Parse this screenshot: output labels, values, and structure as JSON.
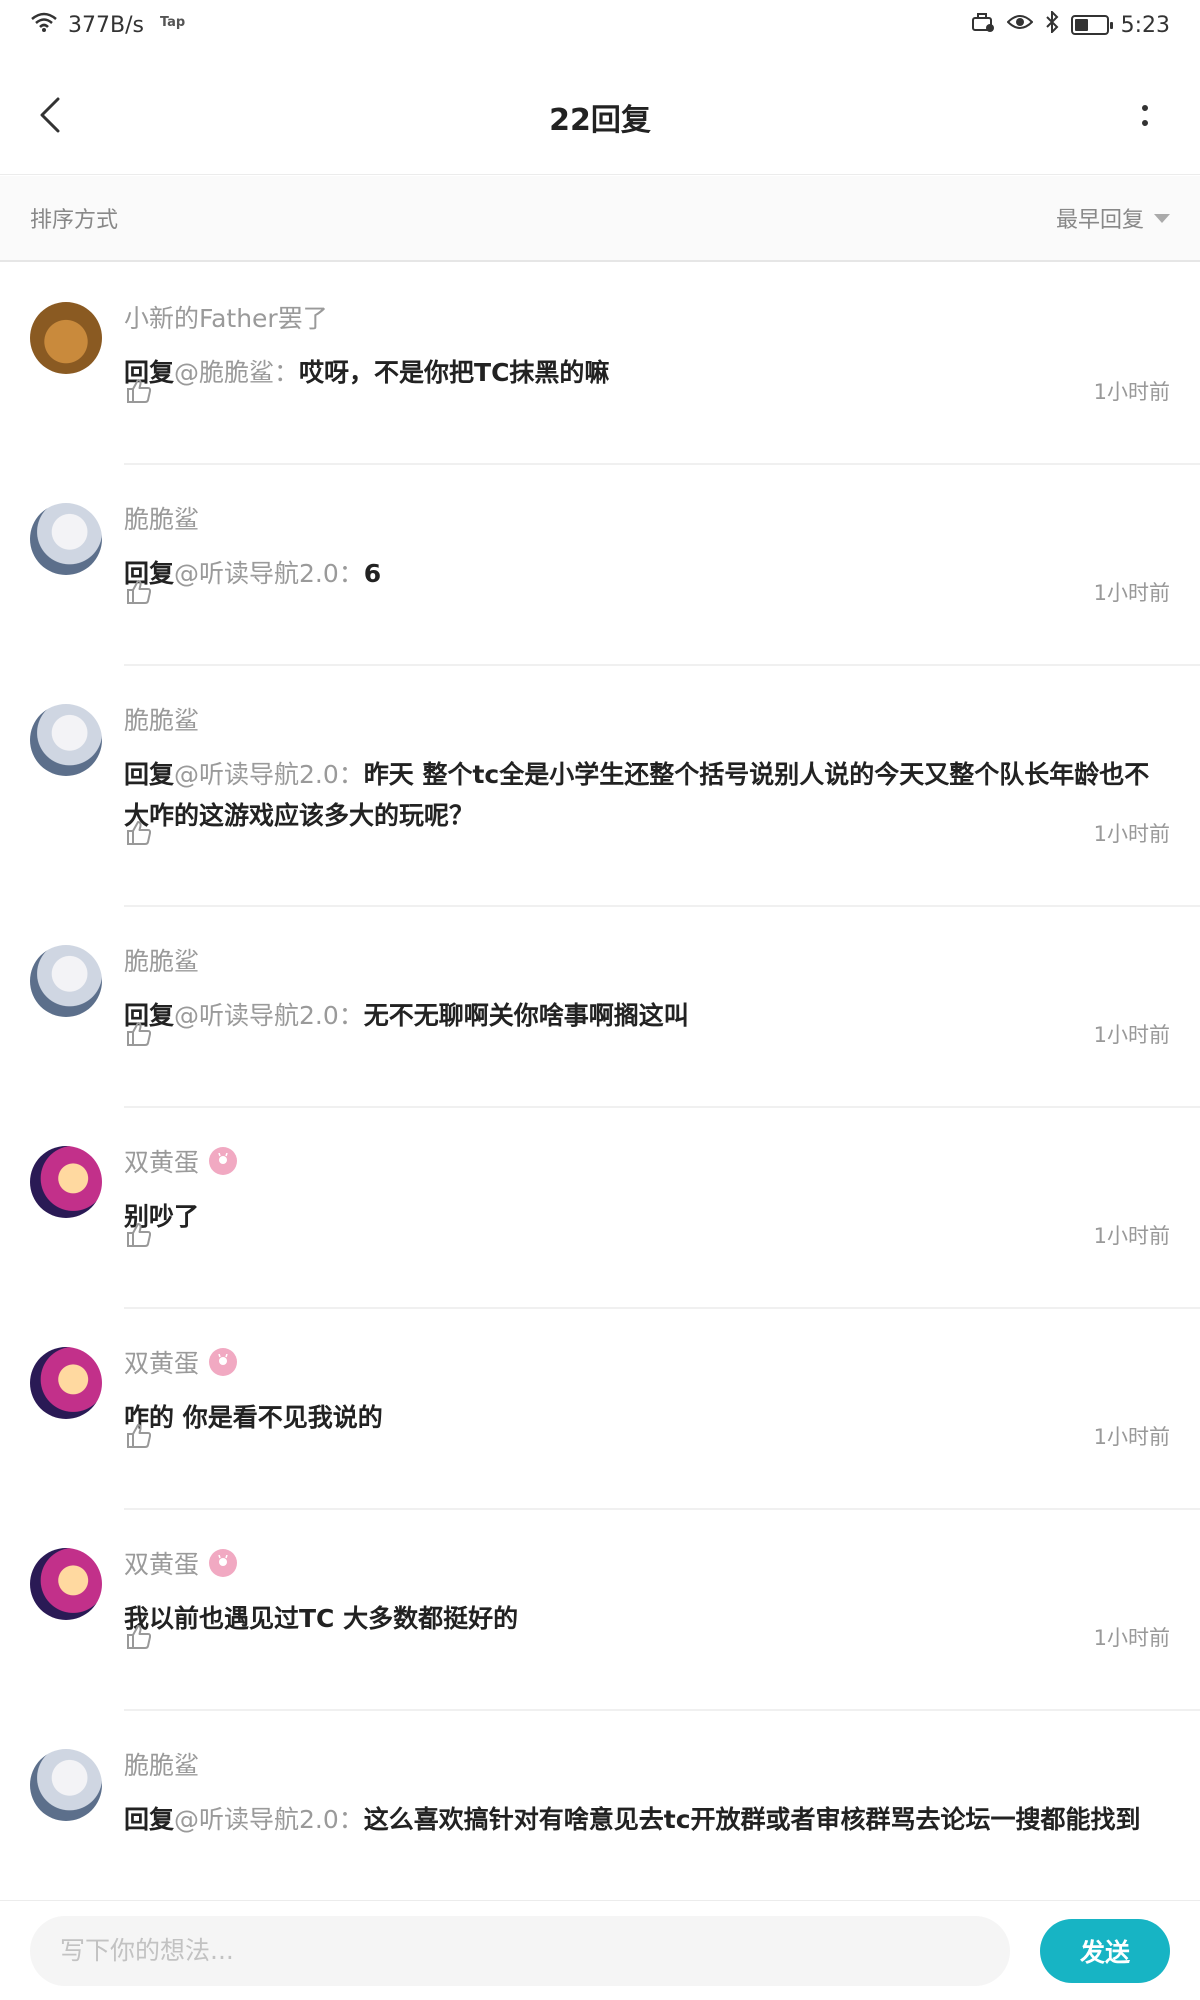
{
  "status_bar": {
    "network_speed": "377B/s",
    "tap_label": "Tap",
    "time": "5:23",
    "battery_level": 0.45
  },
  "header": {
    "title": "22回复"
  },
  "sort": {
    "label": "排序方式",
    "selected": "最早回复"
  },
  "comments": [
    {
      "username": "小新的Father罢了",
      "reply_prefix": "回复",
      "mention": "@脆脆鲨：",
      "text": "哎呀，不是你把TC抹黑的嘛",
      "time": "1小时前",
      "avatar": "bear-avatar"
    },
    {
      "username": "脆脆鲨",
      "reply_prefix": "回复",
      "mention": "@听读导航2.0：",
      "text": "6",
      "time": "1小时前",
      "avatar": "anime-girl-avatar"
    },
    {
      "username": "脆脆鲨",
      "reply_prefix": "回复",
      "mention": "@听读导航2.0：",
      "text": "昨天 整个tc全是小学生还整个括号说别人说的今天又整个队长年龄也不大咋的这游戏应该多大的玩呢？",
      "time": "1小时前",
      "avatar": "anime-girl-avatar"
    },
    {
      "username": "脆脆鲨",
      "reply_prefix": "回复",
      "mention": "@听读导航2.0：",
      "text": "无不无聊啊关你啥事啊搁这叫",
      "time": "1小时前",
      "avatar": "anime-girl-avatar"
    },
    {
      "username": "双黄蛋",
      "reply_prefix": "",
      "mention": "",
      "text": "别吵了",
      "time": "1小时前",
      "avatar": "anime-duo-avatar",
      "badge": true
    },
    {
      "username": "双黄蛋",
      "reply_prefix": "",
      "mention": "",
      "text": "咋的 你是看不见我说的",
      "time": "1小时前",
      "avatar": "anime-duo-avatar",
      "badge": true
    },
    {
      "username": "双黄蛋",
      "reply_prefix": "",
      "mention": "",
      "text": "我以前也遇见过TC 大多数都挺好的",
      "time": "1小时前",
      "avatar": "anime-duo-avatar",
      "badge": true
    },
    {
      "username": "脆脆鲨",
      "reply_prefix": "回复",
      "mention": "@听读导航2.0：",
      "text": "这么喜欢搞针对有啥意见去tc开放群或者审核群骂去论坛一搜都能找到",
      "time": "",
      "avatar": "anime-girl-avatar"
    }
  ],
  "footer": {
    "input_placeholder": "写下你的想法...",
    "send_label": "发送"
  },
  "colors": {
    "accent": "#17b4c4",
    "muted_text": "#9a9a9a",
    "badge_pink": "#f1a9c2"
  }
}
